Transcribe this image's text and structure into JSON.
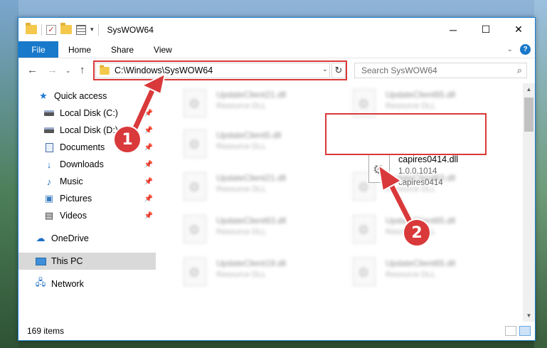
{
  "window": {
    "title": "SysWOW64"
  },
  "ribbon": {
    "tabs": [
      "File",
      "Home",
      "Share",
      "View"
    ]
  },
  "address": {
    "path": "C:\\Windows\\SysWOW64"
  },
  "search": {
    "placeholder": "Search SysWOW64"
  },
  "nav": {
    "items": [
      {
        "label": "Quick access",
        "icon": "star-icon"
      },
      {
        "label": "Local Disk (C:)",
        "icon": "drive-icon",
        "pinned": true
      },
      {
        "label": "Local Disk (D:)",
        "icon": "drive-icon",
        "pinned": true
      },
      {
        "label": "Documents",
        "icon": "documents-icon",
        "pinned": true
      },
      {
        "label": "Downloads",
        "icon": "download-icon",
        "pinned": true
      },
      {
        "label": "Music",
        "icon": "music-icon",
        "pinned": true
      },
      {
        "label": "Pictures",
        "icon": "pictures-icon",
        "pinned": true
      },
      {
        "label": "Videos",
        "icon": "videos-icon",
        "pinned": true
      },
      {
        "label": "OneDrive",
        "icon": "cloud-icon"
      },
      {
        "label": "This PC",
        "icon": "pc-icon",
        "selected": true
      },
      {
        "label": "Network",
        "icon": "network-icon"
      }
    ]
  },
  "files": [
    {
      "name": "UpdateClient21.dll",
      "desc": "Resource DLL"
    },
    {
      "name": "UpdateClient65.dll",
      "desc": "Resource DLL"
    },
    {
      "name": "UpdateClient5.dll",
      "desc": "Resource DLL"
    },
    {
      "name": "UpdateClient21.dll",
      "desc": "Resource DLL"
    },
    {
      "name": "UpdateClient63.dll",
      "desc": "Resource DLL"
    },
    {
      "name": "UpdateClient63.dll",
      "desc": "Resource DLL"
    },
    {
      "name": "UpdateClient65.dll",
      "desc": "Resource DLL"
    },
    {
      "name": "UpdateClient19.dll",
      "desc": "Resource DLL"
    },
    {
      "name": "UpdateClient65.dll",
      "desc": "Resource DLL"
    }
  ],
  "highlighted_file": {
    "name": "capires0414.dll",
    "version": "1.0.0.1014",
    "product": "capires0414"
  },
  "status": {
    "items": "169 items"
  },
  "callouts": {
    "one": "1",
    "two": "2"
  },
  "colors": {
    "accent": "#1979ca",
    "highlight": "#d9393a"
  }
}
